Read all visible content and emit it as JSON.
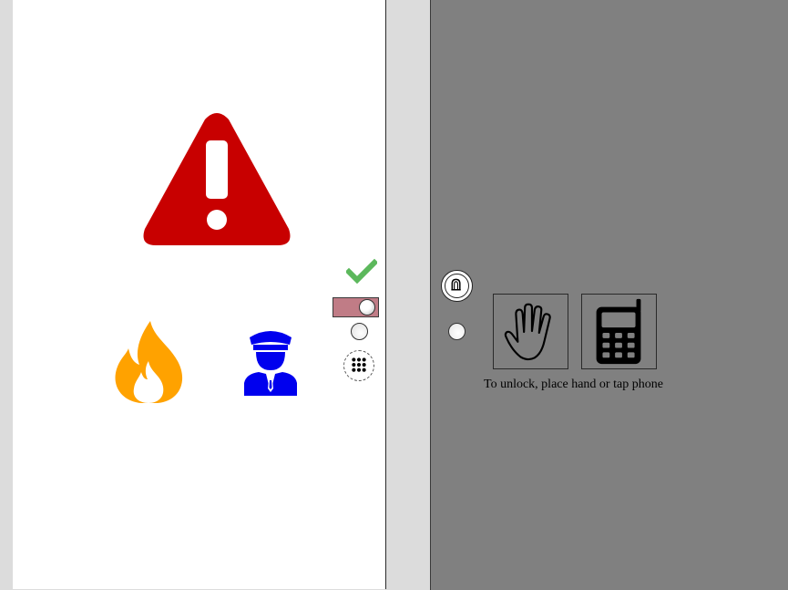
{
  "colors": {
    "warning_red": "#c80000",
    "fire_orange": "#ffa200",
    "police_blue": "#0000ee",
    "check_green": "#5cb85c",
    "toggle_on": "#c07c86",
    "right_panel_bg": "#808080",
    "left_panel_bg": "#ffffff",
    "frame_bg": "#dcdcdc"
  },
  "left_panel": {
    "alert": {
      "icon": "warning-triangle-icon"
    },
    "emergency_options": [
      {
        "icon": "fire-icon",
        "label": ""
      },
      {
        "icon": "police-officer-icon",
        "label": ""
      }
    ],
    "controls": {
      "confirm_icon": "checkmark-icon",
      "toggle_state": "on",
      "keypad_icon": "keypad-grid-icon"
    }
  },
  "right_panel": {
    "doorbell_icon": "doorbell-icon",
    "unlock_methods": [
      {
        "icon": "hand-icon"
      },
      {
        "icon": "mobile-phone-icon"
      }
    ],
    "unlock_instruction": "To unlock, place hand or tap phone"
  }
}
